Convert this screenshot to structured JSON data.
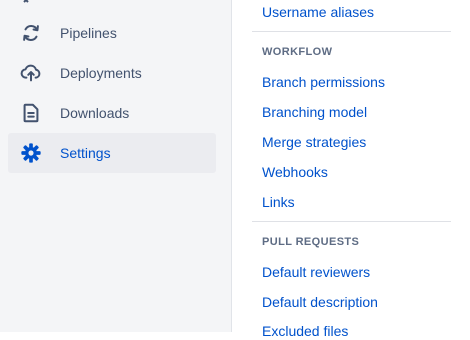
{
  "sidebar": {
    "items": [
      {
        "label": "Pipelines",
        "icon": "pipelines-icon"
      },
      {
        "label": "Deployments",
        "icon": "deployments-icon"
      },
      {
        "label": "Downloads",
        "icon": "downloads-icon"
      },
      {
        "label": "Settings",
        "icon": "settings-icon",
        "active": true
      }
    ]
  },
  "settings_nav": {
    "top_links": [
      "Username aliases"
    ],
    "workflow": {
      "heading": "WORKFLOW",
      "links": [
        "Branch permissions",
        "Branching model",
        "Merge strategies",
        "Webhooks",
        "Links"
      ]
    },
    "pull_requests": {
      "heading": "PULL REQUESTS",
      "links": [
        "Default reviewers",
        "Default description",
        "Excluded files"
      ]
    }
  },
  "colors": {
    "sidebar_bg": "#f4f5f7",
    "link": "#0052cc",
    "nav_text": "#42526e",
    "active_bg": "#ebecf0",
    "heading": "#5e6c84"
  }
}
